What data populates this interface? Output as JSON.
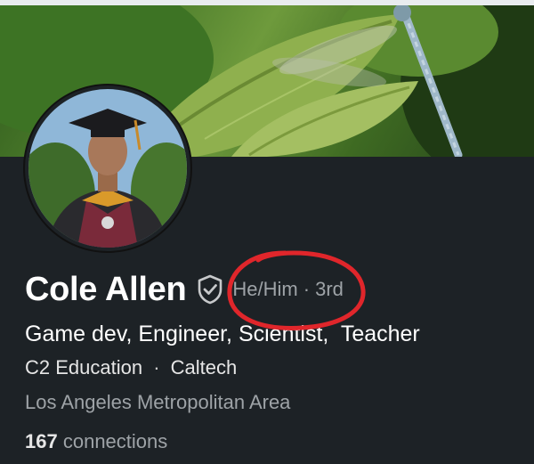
{
  "profile": {
    "name": "Cole Allen",
    "verified_icon": "shield-check-icon",
    "pronouns": "He/Him",
    "degree_separator": "·",
    "degree": "3rd",
    "headline": "Game dev, Engineer, Scientist,  Teacher",
    "education": {
      "company": "C2 Education",
      "separator": "·",
      "school": "Caltech"
    },
    "location": "Los Angeles Metropolitan Area",
    "connections": {
      "count": "167",
      "label": "connections"
    }
  },
  "annotation": {
    "color": "#e0262b"
  },
  "colors": {
    "background": "#1d2226",
    "name_text": "#ffffff",
    "muted_text": "#9ea3a7"
  }
}
